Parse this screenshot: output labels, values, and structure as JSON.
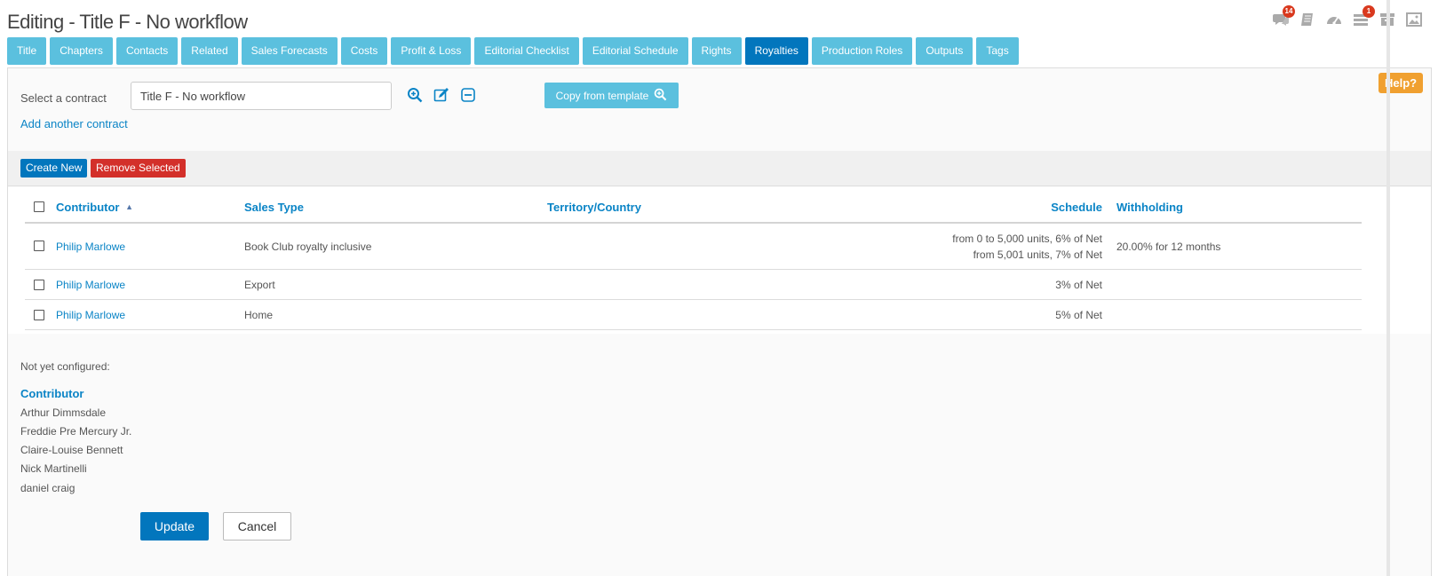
{
  "page": {
    "title": "Editing - Title F - No workflow"
  },
  "top_icons": [
    {
      "name": "comments-icon",
      "badge": "14"
    },
    {
      "name": "notebook-icon",
      "badge": ""
    },
    {
      "name": "dashboard-icon",
      "badge": ""
    },
    {
      "name": "task-list-icon",
      "badge": "1"
    },
    {
      "name": "archive-icon",
      "badge": ""
    },
    {
      "name": "image-icon",
      "badge": ""
    }
  ],
  "tabs": [
    {
      "label": "Title"
    },
    {
      "label": "Chapters"
    },
    {
      "label": "Contacts"
    },
    {
      "label": "Related"
    },
    {
      "label": "Sales Forecasts"
    },
    {
      "label": "Costs"
    },
    {
      "label": "Profit & Loss"
    },
    {
      "label": "Editorial Checklist"
    },
    {
      "label": "Editorial Schedule"
    },
    {
      "label": "Rights"
    },
    {
      "label": "Royalties",
      "active": true
    },
    {
      "label": "Production Roles"
    },
    {
      "label": "Outputs"
    },
    {
      "label": "Tags"
    }
  ],
  "help": {
    "label": "Help?"
  },
  "contract": {
    "select_label": "Select a contract",
    "value": "Title F - No workflow",
    "add_another": "Add another contract",
    "copy_template": "Copy from template"
  },
  "toolbar": {
    "create_new": "Create New",
    "remove_selected": "Remove Selected"
  },
  "table": {
    "headers": {
      "contributor": "Contributor",
      "sales_type": "Sales Type",
      "territory": "Territory/Country",
      "schedule": "Schedule",
      "withholding": "Withholding"
    },
    "rows": [
      {
        "contributor": "Philip Marlowe",
        "sales_type": "Book Club royalty inclusive",
        "territory": "",
        "schedule_line1": "from 0 to 5,000 units, 6% of Net",
        "schedule_line2": "from 5,001 units, 7% of Net",
        "withholding": "20.00% for 12 months"
      },
      {
        "contributor": "Philip Marlowe",
        "sales_type": "Export",
        "territory": "",
        "schedule_line1": "3% of Net",
        "schedule_line2": "",
        "withholding": ""
      },
      {
        "contributor": "Philip Marlowe",
        "sales_type": "Home",
        "territory": "",
        "schedule_line1": "5% of Net",
        "schedule_line2": "",
        "withholding": ""
      }
    ]
  },
  "not_configured": {
    "label": "Not yet configured:",
    "heading": "Contributor",
    "items": [
      "Arthur Dimmsdale",
      "Freddie Pre Mercury Jr.",
      "Claire-Louise Bennett",
      "Nick Martinelli",
      "daniel craig"
    ]
  },
  "actions": {
    "update": "Update",
    "cancel": "Cancel"
  },
  "colors": {
    "tab": "#5bc0de",
    "tab_active": "#0276bd",
    "link": "#0a84c6",
    "danger": "#d3302a",
    "help": "#f0a030"
  }
}
